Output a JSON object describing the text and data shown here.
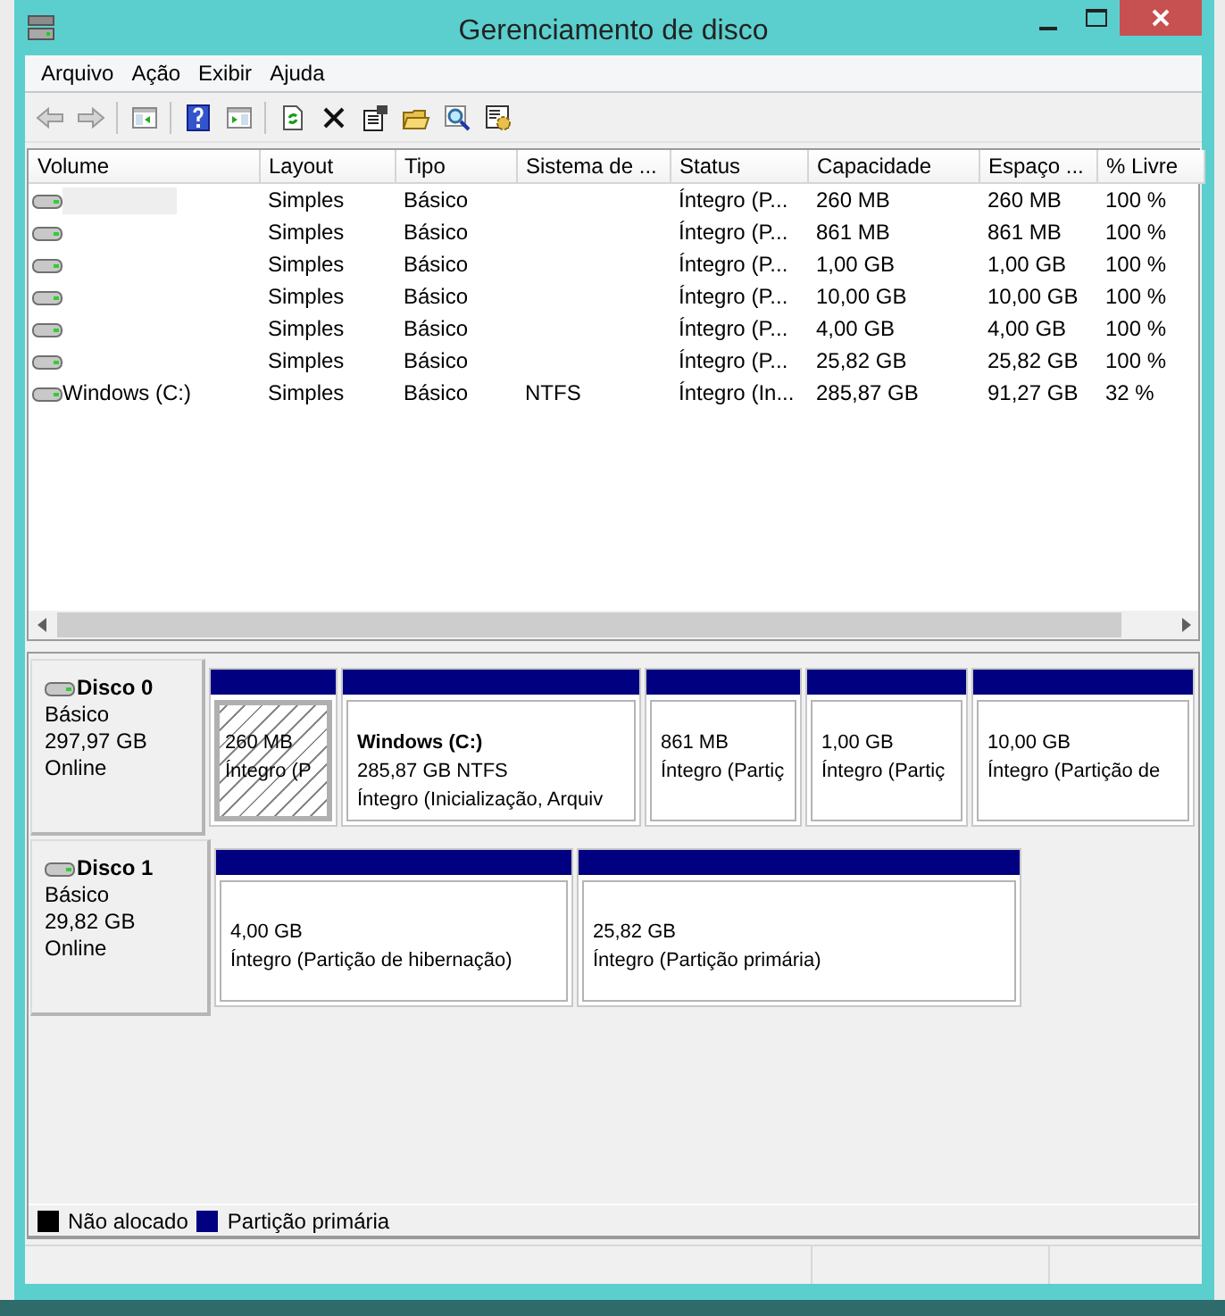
{
  "window": {
    "title": "Gerenciamento de disco"
  },
  "menu": [
    {
      "label": "Arquivo"
    },
    {
      "label": "Ação"
    },
    {
      "label": "Exibir"
    },
    {
      "label": "Ajuda"
    }
  ],
  "toolbar": [
    {
      "kind": "back",
      "disabled": true
    },
    {
      "kind": "forward",
      "disabled": true
    },
    {
      "kind": "sep"
    },
    {
      "kind": "tree",
      "disabled": false
    },
    {
      "kind": "sep"
    },
    {
      "kind": "help",
      "disabled": false
    },
    {
      "kind": "pane",
      "disabled": false
    },
    {
      "kind": "sep"
    },
    {
      "kind": "refresh",
      "disabled": false
    },
    {
      "kind": "delete",
      "disabled": false
    },
    {
      "kind": "properties",
      "disabled": false
    },
    {
      "kind": "folder",
      "disabled": false
    },
    {
      "kind": "search",
      "disabled": false
    },
    {
      "kind": "gear",
      "disabled": false
    }
  ],
  "table": {
    "columns": [
      "Volume",
      "Layout",
      "Tipo",
      "Sistema de ...",
      "Status",
      "Capacidade",
      "Espaço ...",
      "% Livre"
    ],
    "rows": [
      {
        "selected": true,
        "cells": [
          "",
          "Simples",
          "Básico",
          "",
          "Íntegro (P...",
          "260 MB",
          "260 MB",
          "100 %"
        ]
      },
      {
        "selected": false,
        "cells": [
          "",
          "Simples",
          "Básico",
          "",
          "Íntegro (P...",
          "861 MB",
          "861 MB",
          "100 %"
        ]
      },
      {
        "selected": false,
        "cells": [
          "",
          "Simples",
          "Básico",
          "",
          "Íntegro (P...",
          "1,00 GB",
          "1,00 GB",
          "100 %"
        ]
      },
      {
        "selected": false,
        "cells": [
          "",
          "Simples",
          "Básico",
          "",
          "Íntegro (P...",
          "10,00 GB",
          "10,00 GB",
          "100 %"
        ]
      },
      {
        "selected": false,
        "cells": [
          "",
          "Simples",
          "Básico",
          "",
          "Íntegro (P...",
          "4,00 GB",
          "4,00 GB",
          "100 %"
        ]
      },
      {
        "selected": false,
        "cells": [
          "",
          "Simples",
          "Básico",
          "",
          "Íntegro (P...",
          "25,82 GB",
          "25,82 GB",
          "100 %"
        ]
      },
      {
        "selected": false,
        "cells": [
          "Windows (C:)",
          "Simples",
          "Básico",
          "NTFS",
          "Íntegro (In...",
          "285,87 GB",
          "91,27 GB",
          "32 %"
        ]
      }
    ]
  },
  "disks": [
    {
      "name": "Disco 0",
      "type": "Básico",
      "size": "297,97 GB",
      "status": "Online",
      "partitions": [
        {
          "kind": "primary",
          "selected": true,
          "lines": [
            "260 MB",
            "Íntegro (P"
          ]
        },
        {
          "kind": "primary",
          "selected": false,
          "title": "Windows  (C:)",
          "lines": [
            "285,87 GB NTFS",
            "Íntegro (Inicialização, Arquiv"
          ]
        },
        {
          "kind": "primary",
          "selected": false,
          "lines": [
            "861 MB",
            "Íntegro (Partiç"
          ]
        },
        {
          "kind": "primary",
          "selected": false,
          "lines": [
            "1,00 GB",
            "Íntegro (Partiç"
          ]
        },
        {
          "kind": "primary",
          "selected": false,
          "lines": [
            "10,00 GB",
            "Íntegro (Partição de"
          ]
        }
      ]
    },
    {
      "name": "Disco 1",
      "type": "Básico",
      "size": "29,82 GB",
      "status": "Online",
      "partitions": [
        {
          "kind": "primary",
          "selected": false,
          "lines": [
            "4,00 GB",
            "Íntegro (Partição de hibernação)"
          ]
        },
        {
          "kind": "primary",
          "selected": false,
          "lines": [
            "25,82 GB",
            "Íntegro (Partição primária)"
          ]
        }
      ]
    }
  ],
  "legend": [
    {
      "kind": "unallocated",
      "label": "Não alocado",
      "color": "#000000"
    },
    {
      "kind": "primary",
      "label": "Partição primária",
      "color": "#000080"
    }
  ]
}
